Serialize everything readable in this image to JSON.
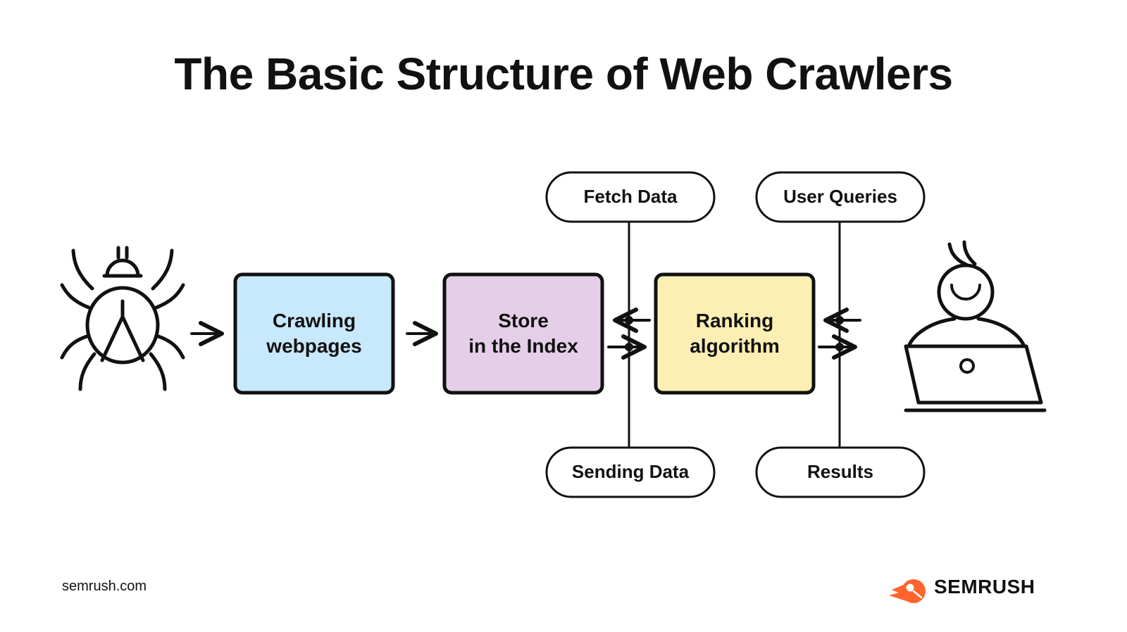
{
  "page": {
    "title": "The Basic Structure of Web Crawlers",
    "background_color": "#FFFFFF",
    "text_color": "#111111"
  },
  "footer": {
    "url": "semrush.com",
    "brand_name": "SEMRUSH",
    "brand_icon": "semrush-comet-icon",
    "brand_color": "#FF642D"
  },
  "diagram": {
    "type": "flowchart",
    "stages": [
      {
        "id": "crawler",
        "kind": "icon",
        "icon": "spider-icon",
        "label": ""
      },
      {
        "id": "crawling-webpages",
        "kind": "box",
        "label_line1": "Crawling",
        "label_line2": "webpages",
        "fill": "#C8E8FB",
        "stroke": "#111111"
      },
      {
        "id": "store-in-the-index",
        "kind": "box",
        "label_line1": "Store",
        "label_line2": "in the Index",
        "fill": "#E5CEE8",
        "stroke": "#111111"
      },
      {
        "id": "ranking-algorithm",
        "kind": "box",
        "label_line1": "Ranking",
        "label_line2": "algorithm",
        "fill": "#FCEFB4",
        "stroke": "#111111"
      },
      {
        "id": "user",
        "kind": "icon",
        "icon": "person-at-laptop-icon",
        "label": ""
      }
    ],
    "pills": [
      {
        "id": "fetch-data",
        "label": "Fetch Data",
        "position": "top",
        "column": "left"
      },
      {
        "id": "user-queries",
        "label": "User Queries",
        "position": "top",
        "column": "right"
      },
      {
        "id": "sending-data",
        "label": "Sending Data",
        "position": "bottom",
        "column": "left"
      },
      {
        "id": "results",
        "label": "Results",
        "position": "bottom",
        "column": "right"
      }
    ],
    "connectors": [
      {
        "from": "crawler",
        "to": "crawling-webpages",
        "style": "arrow-right"
      },
      {
        "from": "crawling-webpages",
        "to": "store-in-the-index",
        "style": "arrow-right"
      },
      {
        "from": "ranking-algorithm",
        "to": "store-in-the-index",
        "style": "arrow-left",
        "label": "Fetch Data"
      },
      {
        "from": "store-in-the-index",
        "to": "ranking-algorithm",
        "style": "arrow-right",
        "label": "Sending Data"
      },
      {
        "from": "user",
        "to": "ranking-algorithm",
        "style": "arrow-left",
        "label": "User Queries"
      },
      {
        "from": "ranking-algorithm",
        "to": "user",
        "style": "arrow-right",
        "label": "Results"
      }
    ]
  }
}
